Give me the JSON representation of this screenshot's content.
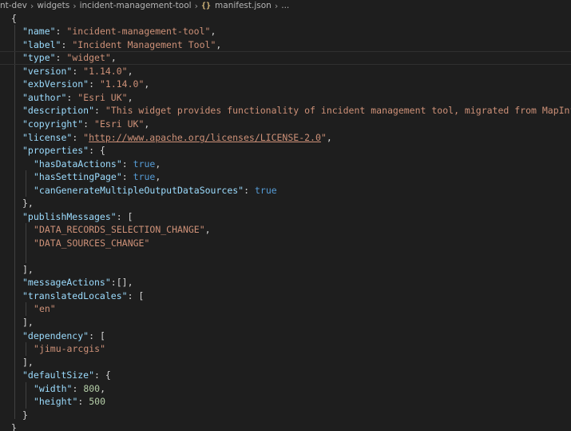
{
  "breadcrumb": {
    "items": [
      "nt-dev",
      "widgets",
      "incident-management-tool",
      "manifest.json",
      "..."
    ],
    "json_icon": "{}"
  },
  "editor": {
    "values": {
      "name": "incident-management-tool",
      "label": "Incident Management Tool",
      "type": "widget",
      "version": "1.14.0",
      "exbVersion": "1.14.0",
      "author": "Esri UK",
      "description": "This widget provides functionality of incident management tool, migrated from MapInfo",
      "copyright": "Esri UK",
      "license": "http://www.apache.org/licenses/LICENSE-2.0",
      "hasDataActions": "true",
      "hasSettingPage": "true",
      "canGenerateMultipleOutputDataSources": "true",
      "publishMessages": [
        "DATA_RECORDS_SELECTION_CHANGE",
        "DATA_SOURCES_CHANGE"
      ],
      "messageActions": "[]",
      "translatedLocales": [
        "en"
      ],
      "dependency": [
        "jimu-arcgis"
      ],
      "width": "800",
      "height": "500"
    }
  }
}
